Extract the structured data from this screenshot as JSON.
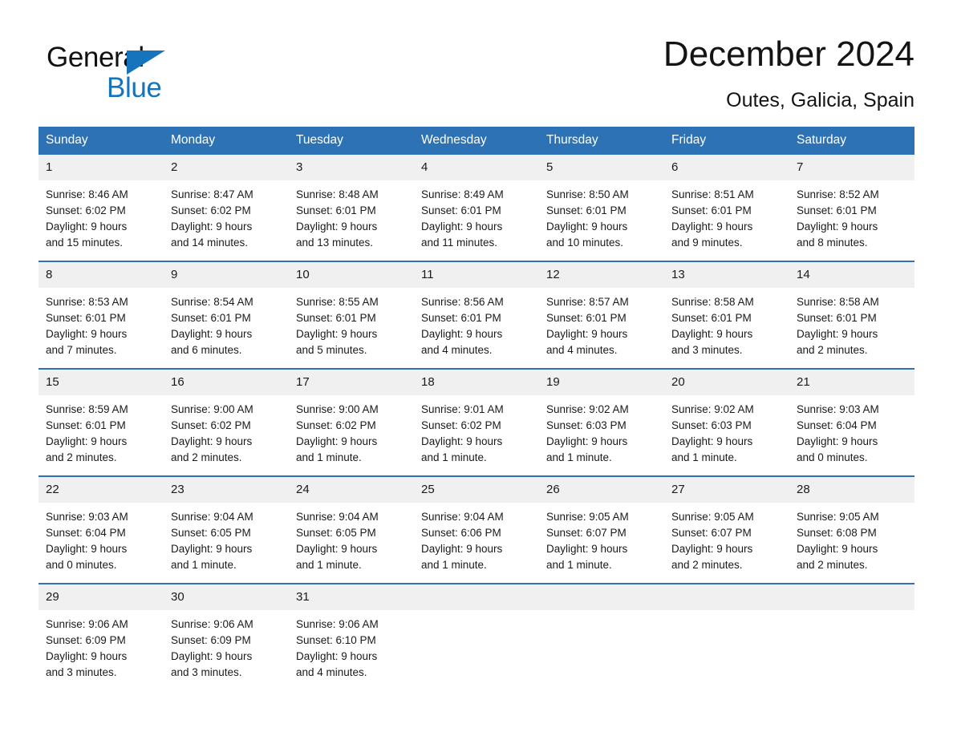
{
  "brand": {
    "name_line1": "General",
    "name_line2": "Blue",
    "logo_icon": "triangle-icon",
    "accent_color": "#1574bb"
  },
  "header": {
    "title": "December 2024",
    "subtitle": "Outes, Galicia, Spain"
  },
  "calendar": {
    "header_bg": "#2d72b4",
    "daynum_bg": "#f0f0f0",
    "separator_color": "#2d72b4",
    "weekday_headers": [
      "Sunday",
      "Monday",
      "Tuesday",
      "Wednesday",
      "Thursday",
      "Friday",
      "Saturday"
    ],
    "weeks": [
      [
        {
          "day": "1",
          "sunrise": "Sunrise: 8:46 AM",
          "sunset": "Sunset: 6:02 PM",
          "daylight_line1": "Daylight: 9 hours",
          "daylight_line2": "and 15 minutes."
        },
        {
          "day": "2",
          "sunrise": "Sunrise: 8:47 AM",
          "sunset": "Sunset: 6:02 PM",
          "daylight_line1": "Daylight: 9 hours",
          "daylight_line2": "and 14 minutes."
        },
        {
          "day": "3",
          "sunrise": "Sunrise: 8:48 AM",
          "sunset": "Sunset: 6:01 PM",
          "daylight_line1": "Daylight: 9 hours",
          "daylight_line2": "and 13 minutes."
        },
        {
          "day": "4",
          "sunrise": "Sunrise: 8:49 AM",
          "sunset": "Sunset: 6:01 PM",
          "daylight_line1": "Daylight: 9 hours",
          "daylight_line2": "and 11 minutes."
        },
        {
          "day": "5",
          "sunrise": "Sunrise: 8:50 AM",
          "sunset": "Sunset: 6:01 PM",
          "daylight_line1": "Daylight: 9 hours",
          "daylight_line2": "and 10 minutes."
        },
        {
          "day": "6",
          "sunrise": "Sunrise: 8:51 AM",
          "sunset": "Sunset: 6:01 PM",
          "daylight_line1": "Daylight: 9 hours",
          "daylight_line2": "and 9 minutes."
        },
        {
          "day": "7",
          "sunrise": "Sunrise: 8:52 AM",
          "sunset": "Sunset: 6:01 PM",
          "daylight_line1": "Daylight: 9 hours",
          "daylight_line2": "and 8 minutes."
        }
      ],
      [
        {
          "day": "8",
          "sunrise": "Sunrise: 8:53 AM",
          "sunset": "Sunset: 6:01 PM",
          "daylight_line1": "Daylight: 9 hours",
          "daylight_line2": "and 7 minutes."
        },
        {
          "day": "9",
          "sunrise": "Sunrise: 8:54 AM",
          "sunset": "Sunset: 6:01 PM",
          "daylight_line1": "Daylight: 9 hours",
          "daylight_line2": "and 6 minutes."
        },
        {
          "day": "10",
          "sunrise": "Sunrise: 8:55 AM",
          "sunset": "Sunset: 6:01 PM",
          "daylight_line1": "Daylight: 9 hours",
          "daylight_line2": "and 5 minutes."
        },
        {
          "day": "11",
          "sunrise": "Sunrise: 8:56 AM",
          "sunset": "Sunset: 6:01 PM",
          "daylight_line1": "Daylight: 9 hours",
          "daylight_line2": "and 4 minutes."
        },
        {
          "day": "12",
          "sunrise": "Sunrise: 8:57 AM",
          "sunset": "Sunset: 6:01 PM",
          "daylight_line1": "Daylight: 9 hours",
          "daylight_line2": "and 4 minutes."
        },
        {
          "day": "13",
          "sunrise": "Sunrise: 8:58 AM",
          "sunset": "Sunset: 6:01 PM",
          "daylight_line1": "Daylight: 9 hours",
          "daylight_line2": "and 3 minutes."
        },
        {
          "day": "14",
          "sunrise": "Sunrise: 8:58 AM",
          "sunset": "Sunset: 6:01 PM",
          "daylight_line1": "Daylight: 9 hours",
          "daylight_line2": "and 2 minutes."
        }
      ],
      [
        {
          "day": "15",
          "sunrise": "Sunrise: 8:59 AM",
          "sunset": "Sunset: 6:01 PM",
          "daylight_line1": "Daylight: 9 hours",
          "daylight_line2": "and 2 minutes."
        },
        {
          "day": "16",
          "sunrise": "Sunrise: 9:00 AM",
          "sunset": "Sunset: 6:02 PM",
          "daylight_line1": "Daylight: 9 hours",
          "daylight_line2": "and 2 minutes."
        },
        {
          "day": "17",
          "sunrise": "Sunrise: 9:00 AM",
          "sunset": "Sunset: 6:02 PM",
          "daylight_line1": "Daylight: 9 hours",
          "daylight_line2": "and 1 minute."
        },
        {
          "day": "18",
          "sunrise": "Sunrise: 9:01 AM",
          "sunset": "Sunset: 6:02 PM",
          "daylight_line1": "Daylight: 9 hours",
          "daylight_line2": "and 1 minute."
        },
        {
          "day": "19",
          "sunrise": "Sunrise: 9:02 AM",
          "sunset": "Sunset: 6:03 PM",
          "daylight_line1": "Daylight: 9 hours",
          "daylight_line2": "and 1 minute."
        },
        {
          "day": "20",
          "sunrise": "Sunrise: 9:02 AM",
          "sunset": "Sunset: 6:03 PM",
          "daylight_line1": "Daylight: 9 hours",
          "daylight_line2": "and 1 minute."
        },
        {
          "day": "21",
          "sunrise": "Sunrise: 9:03 AM",
          "sunset": "Sunset: 6:04 PM",
          "daylight_line1": "Daylight: 9 hours",
          "daylight_line2": "and 0 minutes."
        }
      ],
      [
        {
          "day": "22",
          "sunrise": "Sunrise: 9:03 AM",
          "sunset": "Sunset: 6:04 PM",
          "daylight_line1": "Daylight: 9 hours",
          "daylight_line2": "and 0 minutes."
        },
        {
          "day": "23",
          "sunrise": "Sunrise: 9:04 AM",
          "sunset": "Sunset: 6:05 PM",
          "daylight_line1": "Daylight: 9 hours",
          "daylight_line2": "and 1 minute."
        },
        {
          "day": "24",
          "sunrise": "Sunrise: 9:04 AM",
          "sunset": "Sunset: 6:05 PM",
          "daylight_line1": "Daylight: 9 hours",
          "daylight_line2": "and 1 minute."
        },
        {
          "day": "25",
          "sunrise": "Sunrise: 9:04 AM",
          "sunset": "Sunset: 6:06 PM",
          "daylight_line1": "Daylight: 9 hours",
          "daylight_line2": "and 1 minute."
        },
        {
          "day": "26",
          "sunrise": "Sunrise: 9:05 AM",
          "sunset": "Sunset: 6:07 PM",
          "daylight_line1": "Daylight: 9 hours",
          "daylight_line2": "and 1 minute."
        },
        {
          "day": "27",
          "sunrise": "Sunrise: 9:05 AM",
          "sunset": "Sunset: 6:07 PM",
          "daylight_line1": "Daylight: 9 hours",
          "daylight_line2": "and 2 minutes."
        },
        {
          "day": "28",
          "sunrise": "Sunrise: 9:05 AM",
          "sunset": "Sunset: 6:08 PM",
          "daylight_line1": "Daylight: 9 hours",
          "daylight_line2": "and 2 minutes."
        }
      ],
      [
        {
          "day": "29",
          "sunrise": "Sunrise: 9:06 AM",
          "sunset": "Sunset: 6:09 PM",
          "daylight_line1": "Daylight: 9 hours",
          "daylight_line2": "and 3 minutes."
        },
        {
          "day": "30",
          "sunrise": "Sunrise: 9:06 AM",
          "sunset": "Sunset: 6:09 PM",
          "daylight_line1": "Daylight: 9 hours",
          "daylight_line2": "and 3 minutes."
        },
        {
          "day": "31",
          "sunrise": "Sunrise: 9:06 AM",
          "sunset": "Sunset: 6:10 PM",
          "daylight_line1": "Daylight: 9 hours",
          "daylight_line2": "and 4 minutes."
        },
        {
          "day": "",
          "sunrise": "",
          "sunset": "",
          "daylight_line1": "",
          "daylight_line2": ""
        },
        {
          "day": "",
          "sunrise": "",
          "sunset": "",
          "daylight_line1": "",
          "daylight_line2": ""
        },
        {
          "day": "",
          "sunrise": "",
          "sunset": "",
          "daylight_line1": "",
          "daylight_line2": ""
        },
        {
          "day": "",
          "sunrise": "",
          "sunset": "",
          "daylight_line1": "",
          "daylight_line2": ""
        }
      ]
    ]
  }
}
